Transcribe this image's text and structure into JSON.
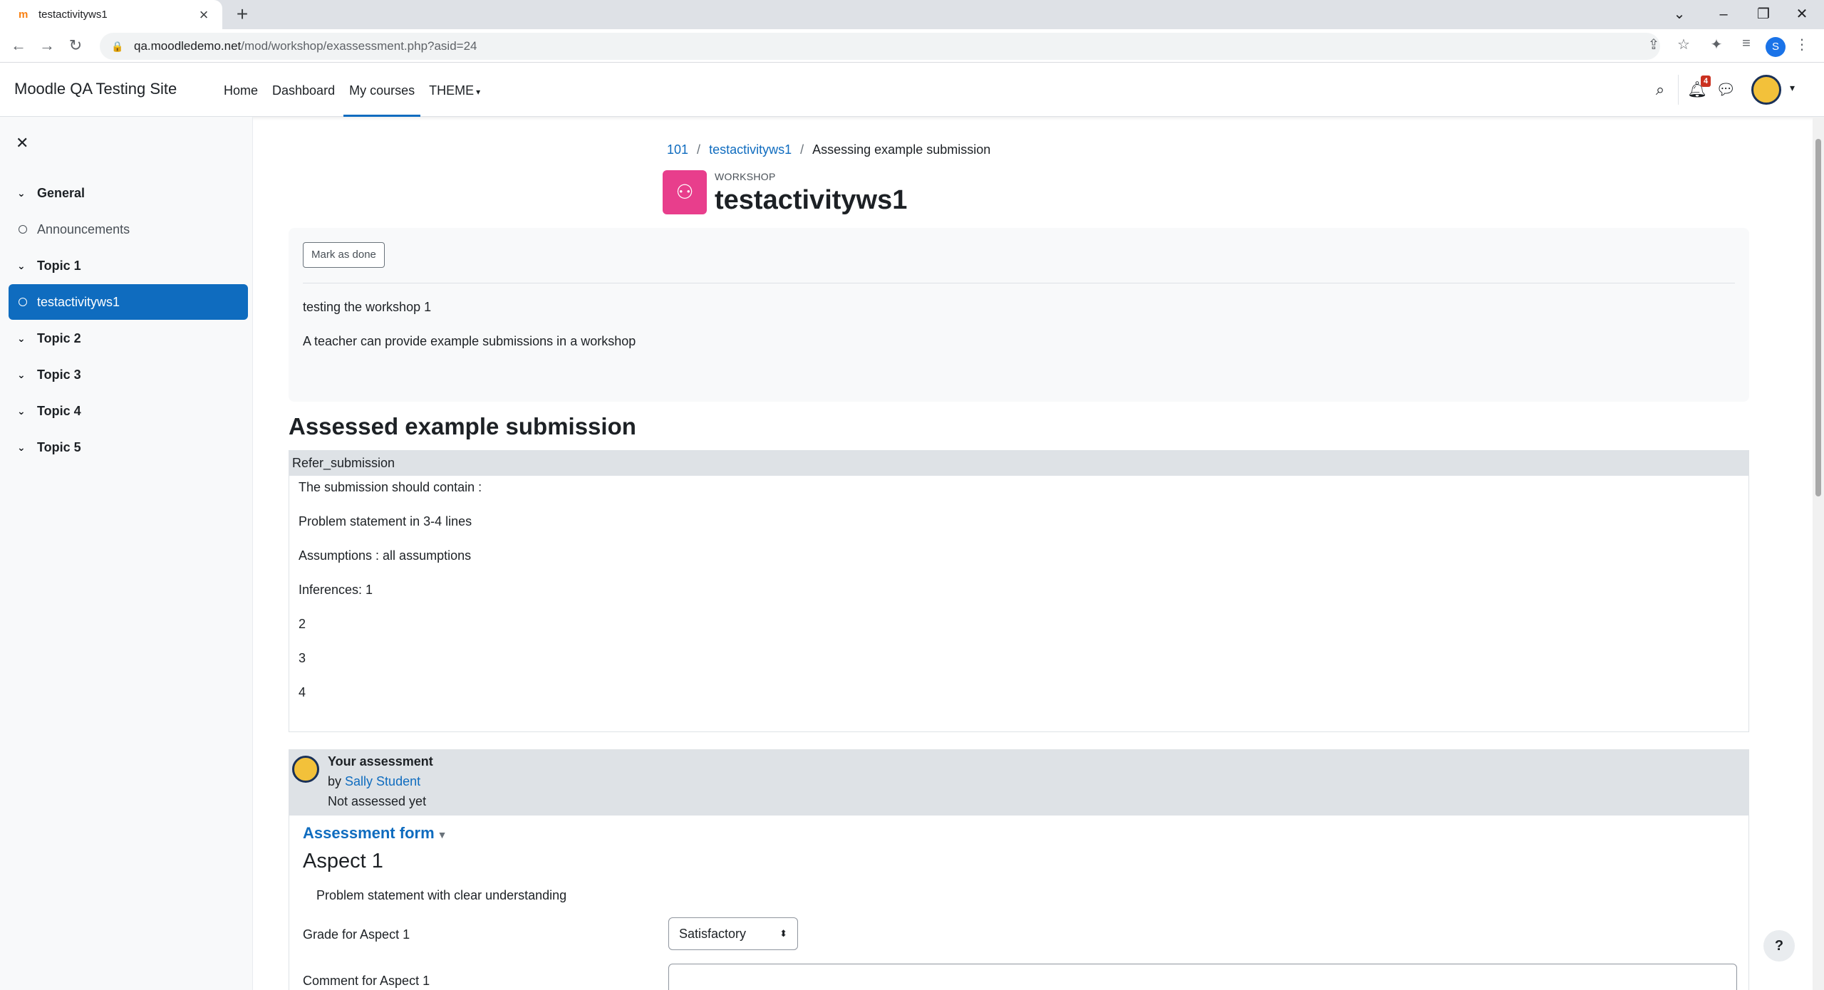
{
  "browser": {
    "tab_title": "testactivityws1",
    "url_host": "qa.moodledemo.net",
    "url_path": "/mod/workshop/exassessment.php?asid=24",
    "profile_initial": "S"
  },
  "navbar": {
    "site_name": "Moodle QA Testing Site",
    "items": [
      {
        "label": "Home"
      },
      {
        "label": "Dashboard"
      },
      {
        "label": "My courses"
      },
      {
        "label": "THEME"
      }
    ],
    "notification_count": "4"
  },
  "drawer": {
    "items": [
      {
        "label": "General",
        "kind": "section"
      },
      {
        "label": "Announcements",
        "kind": "activity"
      },
      {
        "label": "Topic 1",
        "kind": "section"
      },
      {
        "label": "testactivityws1",
        "kind": "activity",
        "active": true
      },
      {
        "label": "Topic 2",
        "kind": "section"
      },
      {
        "label": "Topic 3",
        "kind": "section"
      },
      {
        "label": "Topic 4",
        "kind": "section"
      },
      {
        "label": "Topic 5",
        "kind": "section"
      }
    ]
  },
  "breadcrumb": {
    "items": [
      "101",
      "testactivityws1",
      "Assessing example submission"
    ]
  },
  "activity": {
    "type": "WORKSHOP",
    "title": "testactivityws1",
    "mark_done_label": "Mark as done",
    "description_1": "testing the workshop 1",
    "description_2": "A teacher can provide example submissions in a workshop"
  },
  "submission": {
    "heading": "Assessed example submission",
    "title": "Refer_submission",
    "lines": [
      "The submission should contain :",
      "Problem statement in 3-4 lines",
      "Assumptions : all assumptions",
      "Inferences: 1",
      "2",
      "3",
      "4"
    ]
  },
  "assessment": {
    "title": "Your assessment",
    "by_prefix": "by",
    "author": "Sally Student",
    "status": "Not assessed yet",
    "form_toggle": "Assessment form",
    "aspect_title": "Aspect 1",
    "aspect_desc": "Problem statement with clear understanding",
    "grade_label": "Grade for Aspect 1",
    "grade_value": "Satisfactory",
    "comment_label": "Comment for Aspect 1"
  },
  "help_label": "?"
}
